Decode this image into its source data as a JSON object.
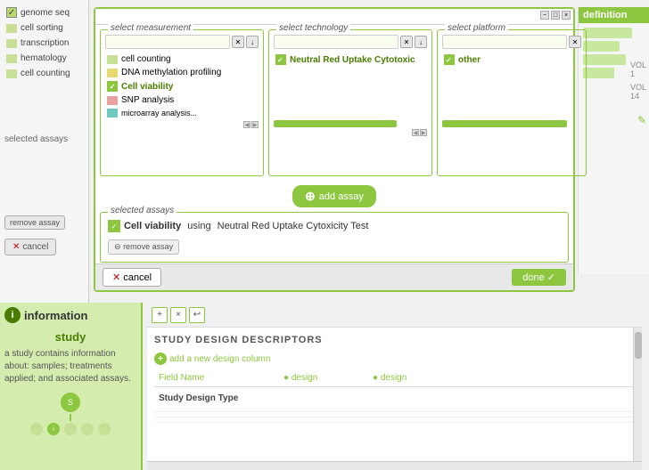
{
  "modal": {
    "title": "",
    "controls": [
      "−",
      "□",
      "×"
    ],
    "col1": {
      "title": "select measurement",
      "search_placeholder": "",
      "items": [
        {
          "label": "cell counting",
          "color": "lime",
          "checked": false,
          "selected": false
        },
        {
          "label": "DNA methylation profiling",
          "color": "yellow",
          "checked": false,
          "selected": false
        },
        {
          "label": "Cell viability",
          "color": "green",
          "checked": true,
          "selected": true
        },
        {
          "label": "SNP analysis",
          "color": "pink",
          "checked": false,
          "selected": false
        },
        {
          "label": "microarray analysis",
          "color": "teal",
          "checked": false,
          "selected": false
        }
      ]
    },
    "col2": {
      "title": "select technology",
      "search_placeholder": "",
      "items": [
        {
          "label": "Neutral Red Uptake Cytotoxic",
          "color": "green",
          "checked": true,
          "selected": true
        }
      ]
    },
    "col3": {
      "title": "select platform",
      "search_placeholder": "",
      "items": [
        {
          "label": "other",
          "color": "green",
          "checked": true,
          "selected": true
        }
      ]
    },
    "add_assay_label": "add assay",
    "selected_assays": {
      "title": "selected assays",
      "items": [
        {
          "measurement": "Cell viability",
          "connector": "using",
          "technology": "Neutral Red Uptake Cytoxicity Test"
        }
      ]
    },
    "remove_assay_label": "remove assay",
    "cancel_label": "cancel",
    "done_label": "done"
  },
  "sidebar": {
    "items": [
      {
        "label": "genome seq",
        "color": "lime"
      },
      {
        "label": "cell sorting",
        "color": "lime"
      },
      {
        "label": "transcription",
        "color": "lime"
      },
      {
        "label": "hematology",
        "color": "lime"
      },
      {
        "label": "cell counting",
        "color": "lime"
      }
    ],
    "selected_assays_label": "selected assays",
    "remove_assay_label": "remove assay",
    "cancel_label": "cancel"
  },
  "right_panel": {
    "title": "definition",
    "bars": [
      {
        "width": 80
      },
      {
        "width": 60
      },
      {
        "width": 70
      },
      {
        "width": 50
      }
    ],
    "labels": [
      "VOL 1",
      "VOL 14"
    ],
    "edit_icon": "✎"
  },
  "bottom": {
    "toolbar": {
      "add_label": "+",
      "remove_label": "×",
      "info_label": "↩"
    },
    "info_panel": {
      "icon": "i",
      "title": "information",
      "study_label": "study",
      "description": "a study contains information about: samples; treatments applied; and associated assays."
    },
    "main": {
      "section_title": "STUDY DESIGN DESCRIPTORS",
      "add_column_label": "add a new design column",
      "table": {
        "headers": [
          "Field Name",
          "design",
          "design"
        ],
        "rows": [
          {
            "field": "Study Design Type",
            "col1": "",
            "col2": ""
          }
        ]
      }
    }
  }
}
